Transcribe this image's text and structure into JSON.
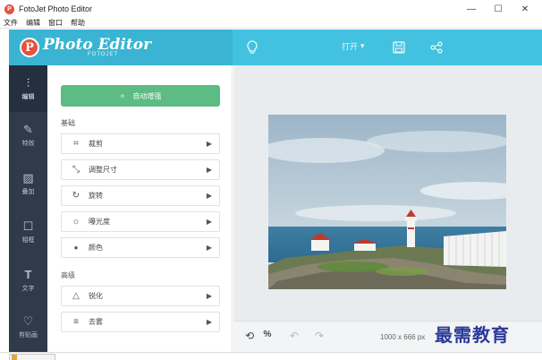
{
  "window": {
    "title": "FotoJet Photo Editor",
    "controls": {
      "minimize": "—",
      "maximize": "☐",
      "close": "✕"
    }
  },
  "menu": [
    "文件",
    "编辑",
    "窗口",
    "帮助"
  ],
  "header": {
    "logo_text": "Photo Editor",
    "logo_sub": "FOTOJET",
    "open_label": "打开",
    "icons": [
      "lightbulb-icon",
      "save-icon",
      "share-icon"
    ]
  },
  "rail": [
    {
      "label": "编辑",
      "icon": "⫶",
      "active": true
    },
    {
      "label": "特效",
      "icon": "✎"
    },
    {
      "label": "叠加",
      "icon": "▨"
    },
    {
      "label": "相框",
      "icon": "☐"
    },
    {
      "label": "文字",
      "icon": "T"
    },
    {
      "label": "剪贴画",
      "icon": "♡"
    }
  ],
  "panel": {
    "auto_enhance": "自动增强",
    "basic_title": "基础",
    "basic_tools": [
      {
        "label": "裁剪",
        "icon": "⌗"
      },
      {
        "label": "调整尺寸",
        "icon": "⤡"
      },
      {
        "label": "旋转",
        "icon": "↻"
      },
      {
        "label": "曝光度",
        "icon": "☼"
      },
      {
        "label": "颜色",
        "icon": "●"
      }
    ],
    "advanced_title": "高级",
    "advanced_tools": [
      {
        "label": "锐化",
        "icon": "△"
      },
      {
        "label": "去雾",
        "icon": "≡"
      }
    ]
  },
  "bottom": {
    "dimensions": "1000 x 666 px",
    "icons": [
      "reset-icon",
      "compare-icon",
      "undo-icon",
      "redo-icon"
    ]
  },
  "watermark": "最需教育",
  "colors": {
    "header": "#42c2e0",
    "rail": "#2f3a4a",
    "auto_button": "#5cbc84",
    "logo": "#e8513d"
  }
}
